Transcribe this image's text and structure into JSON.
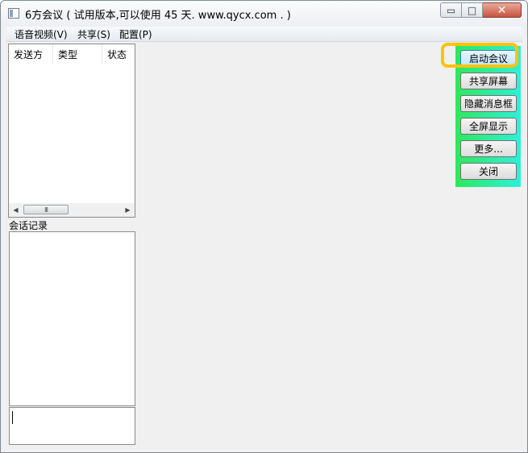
{
  "window": {
    "title": "6方会议 ( 试用版本,可以使用 45 天. www.qycx.com . )",
    "app_icon": "window-app-icon",
    "minimize_glyph": "▭",
    "maximize_glyph": "□",
    "close_glyph": "✕"
  },
  "menu": {
    "items": [
      "语音视频(V)",
      "共享(S)",
      "配置(P)"
    ]
  },
  "transfer_list": {
    "columns": [
      "发送方",
      "类型",
      "状态"
    ],
    "scroll_left": "◀",
    "scroll_right": "▶",
    "thumb_grip": "III"
  },
  "chat": {
    "label": "会话记录",
    "input_value": ""
  },
  "buttons": {
    "start_meeting": "启动会议",
    "share_screen": "共享屏幕",
    "hide_message_box": "隐藏消息框",
    "fullscreen": "全屏显示",
    "more": "更多...",
    "close": "关闭"
  },
  "colors": {
    "panel_gradient_start": "#2ee85c",
    "panel_gradient_end": "#2ef0d8",
    "highlight": "#ffc20e"
  }
}
